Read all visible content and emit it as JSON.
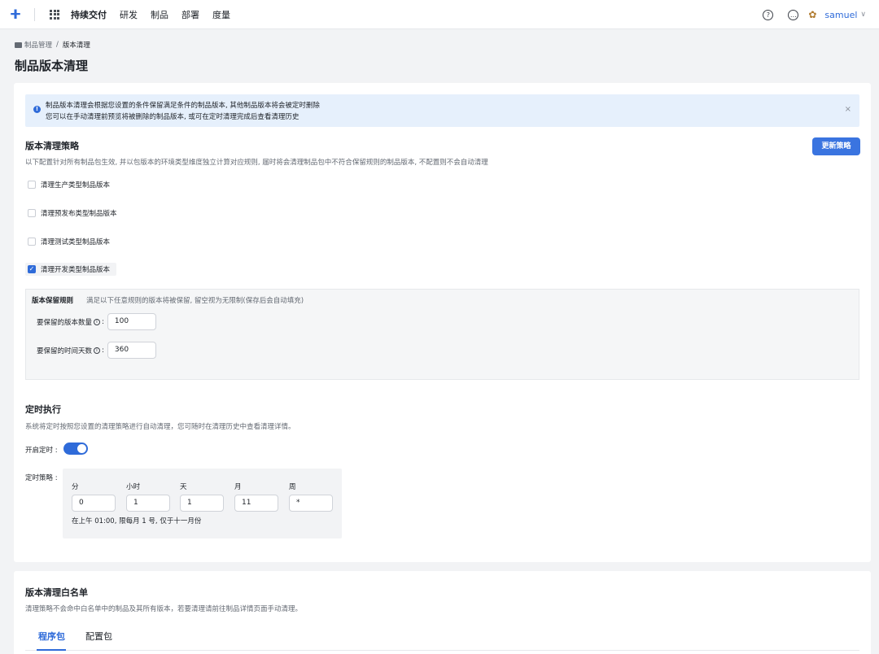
{
  "topbar": {
    "logo": "ⵜ",
    "nav": [
      "持续交付",
      "研发",
      "制品",
      "部署",
      "度量"
    ],
    "username": "samuel"
  },
  "breadcrumb": {
    "parent": "制品管理",
    "current": "版本清理"
  },
  "page_title": "制品版本清理",
  "alert": {
    "line1": "制品版本清理会根据您设置的条件保留满足条件的制品版本, 其他制品版本将会被定时删除",
    "line2": "您可以在手动清理前预览将被删除的制品版本, 或可在定时清理完成后查看清理历史"
  },
  "policy": {
    "title": "版本清理策略",
    "desc": "以下配置针对所有制品包生效, 并以包版本的环境类型维度独立计算对应规则, 届时将会清理制品包中不符合保留规则的制品版本, 不配置则不会自动清理",
    "update_button": "更新策略",
    "options": [
      {
        "label": "清理生产类型制品版本",
        "checked": false
      },
      {
        "label": "清理预发布类型制品版本",
        "checked": false
      },
      {
        "label": "清理测试类型制品版本",
        "checked": false
      },
      {
        "label": "清理开发类型制品版本",
        "checked": true
      }
    ],
    "rules": {
      "title": "版本保留规则",
      "desc": "满足以下任意规则的版本将被保留, 留空视为无限制(保存后会自动填充)",
      "count_label": "要保留的版本数量",
      "count_value": "100",
      "days_label": "要保留的时间天数",
      "days_value": "360"
    }
  },
  "schedule": {
    "title": "定时执行",
    "desc": "系统将定时按照您设置的清理策略进行自动清理，您可随时在清理历史中查看清理详情。",
    "enable_label": "开启定时 :",
    "enabled": true,
    "strategy_label": "定时策略 :",
    "fields": [
      {
        "label": "分",
        "value": "0"
      },
      {
        "label": "小时",
        "value": "1"
      },
      {
        "label": "天",
        "value": "1"
      },
      {
        "label": "月",
        "value": "11"
      },
      {
        "label": "周",
        "value": "*"
      }
    ],
    "summary": "在上午 01:00, 限每月 1 号, 仅于十一月份"
  },
  "whitelist": {
    "title": "版本清理白名单",
    "desc": "清理策略不会命中白名单中的制品及其所有版本，若要清理请前往制品详情页面手动清理。",
    "tabs": [
      "程序包",
      "配置包"
    ]
  }
}
